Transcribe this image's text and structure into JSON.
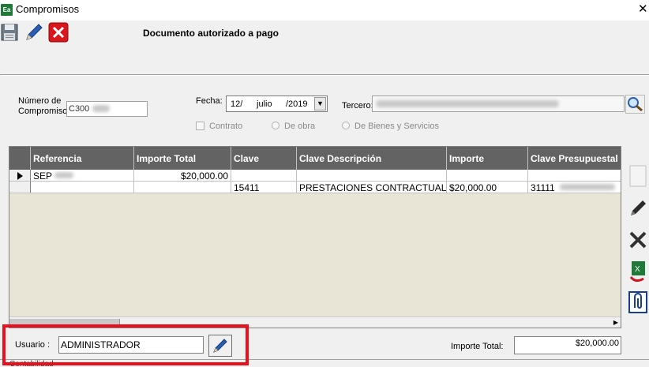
{
  "window": {
    "title": "Compromisos",
    "app_icon": "Ea",
    "close_glyph": "✕"
  },
  "toolbar": {
    "status": "Documento autorizado a pago",
    "icons": [
      "save-icon",
      "edit-pencil-icon",
      "delete-icon"
    ]
  },
  "form": {
    "numero_label_1": "Número de",
    "numero_label_2": "Compromiso:",
    "numero_value": "C300",
    "fecha_label": "Fecha:",
    "fecha_day": "12/",
    "fecha_month": "julio",
    "fecha_year": "/2019",
    "tercero_label": "Tercero:",
    "options": {
      "contrato": "Contrato",
      "de_obra": "De obra",
      "de_bienes": "De Bienes y Servicios"
    }
  },
  "grid": {
    "columns": [
      "Referencia",
      "Importe Total",
      "Clave",
      "Clave Descripción",
      "Importe",
      "Clave Presupuestal"
    ],
    "rows": [
      [
        "SEP",
        "$20,000.00",
        "",
        "",
        "",
        ""
      ],
      [
        "",
        "",
        "15411",
        "PRESTACIONES CONTRACTUALES",
        "$20,000.00",
        "31111"
      ]
    ]
  },
  "side_icons": [
    "blank-icon",
    "pencil-icon",
    "cancel-tool-icon",
    "excel-export-icon",
    "attachment-icon"
  ],
  "footer": {
    "usuario_label": "Usuario :",
    "usuario_value": "ADMINISTRADOR",
    "importe_total_label": "Importe Total:",
    "importe_total_value": "$20,000.00",
    "contabilidad": "Contabilidad"
  },
  "colors": {
    "grid_header": "#636363",
    "grid_bg": "#e8e4d6",
    "highlight": "#e8101d"
  }
}
